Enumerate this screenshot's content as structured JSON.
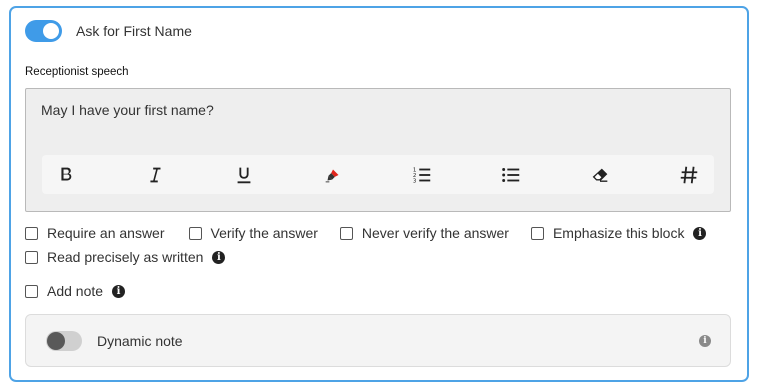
{
  "block": {
    "toggle_label": "Ask for First Name",
    "toggle_on": true
  },
  "speech": {
    "label": "Receptionist speech",
    "text": "May I have your first name?"
  },
  "toolbar": {
    "icons": [
      "bold-icon",
      "italic-icon",
      "underline-icon",
      "highlighter-icon",
      "ordered-list-icon",
      "bullet-list-icon",
      "eraser-icon",
      "hash-icon"
    ],
    "highlight_color": "#e0241b"
  },
  "options": {
    "require_answer": "Require an answer",
    "verify_answer": "Verify the answer",
    "never_verify": "Never verify the answer",
    "emphasize": "Emphasize this block",
    "read_precisely": "Read precisely as written",
    "add_note": "Add note"
  },
  "dynamic_note": {
    "label": "Dynamic note",
    "toggle_on": false
  },
  "colors": {
    "accent": "#3f9be8",
    "border": "#4ea3e6"
  }
}
